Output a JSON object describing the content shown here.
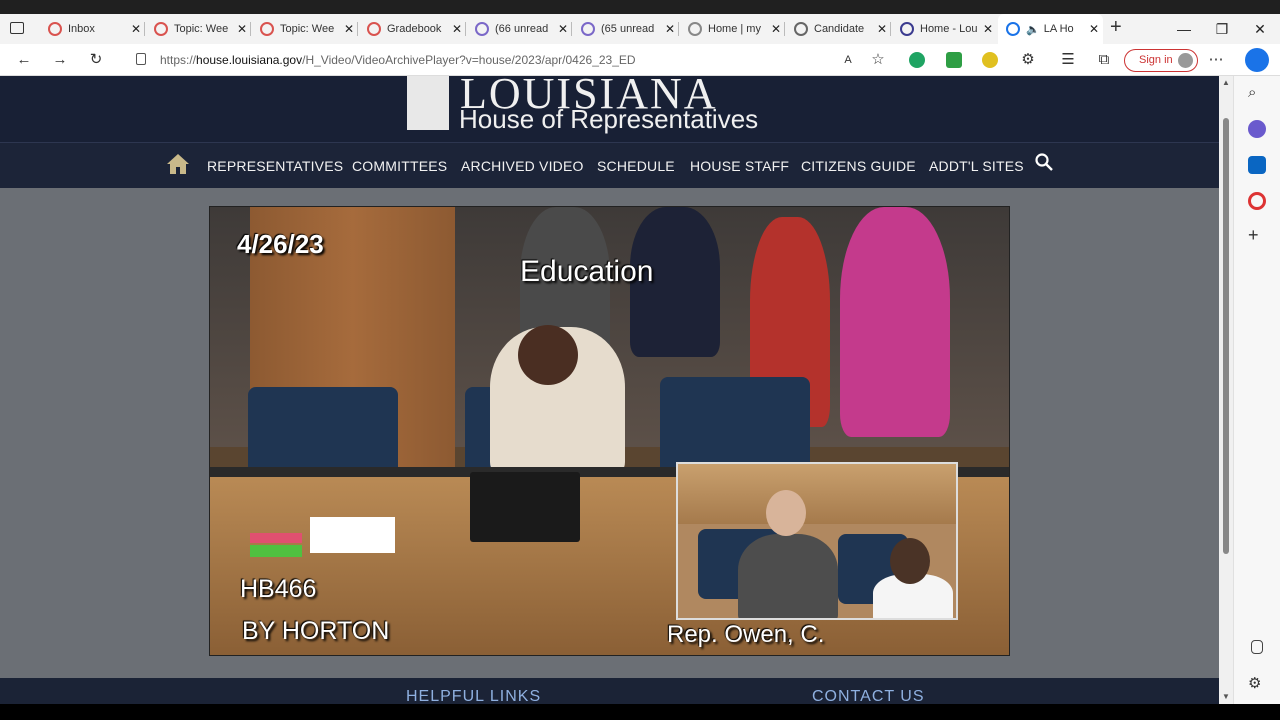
{
  "browser": {
    "tabs": [
      {
        "label": "Inbox",
        "color": "#d9534f"
      },
      {
        "label": "Topic: Wee",
        "color": "#d9534f"
      },
      {
        "label": "Topic: Wee",
        "color": "#d9534f"
      },
      {
        "label": "Gradebook",
        "color": "#d9534f"
      },
      {
        "label": "(66 unread",
        "color": "#7b68c8"
      },
      {
        "label": "(65 unread",
        "color": "#7b68c8"
      },
      {
        "label": "Home | my",
        "color": "#888888"
      },
      {
        "label": "Candidate",
        "color": "#666666"
      },
      {
        "label": "Home - Lou",
        "color": "#3b3b8f"
      },
      {
        "label": "LA Ho",
        "color": "#1a73e8"
      }
    ],
    "url_prefix": "https://",
    "url_domain": "house.louisiana.gov",
    "url_path": "/H_Video/VideoArchivePlayer?v=house/2023/apr/0426_23_ED",
    "signin_label": "Sign in"
  },
  "site": {
    "logo_title": "LOUISIANA",
    "logo_subtitle": "House of Representatives",
    "nav": [
      "REPRESENTATIVES",
      "COMMITTEES",
      "ARCHIVED VIDEO",
      "SCHEDULE",
      "HOUSE STAFF",
      "CITIZENS GUIDE",
      "ADDT'L SITES"
    ]
  },
  "video": {
    "date": "4/26/23",
    "committee": "Education",
    "bill": "HB466",
    "author": "BY HORTON",
    "speaker": "Rep. Owen, C."
  },
  "footer": {
    "helpful_links": "HELPFUL LINKS",
    "contact_us": "CONTACT US"
  }
}
